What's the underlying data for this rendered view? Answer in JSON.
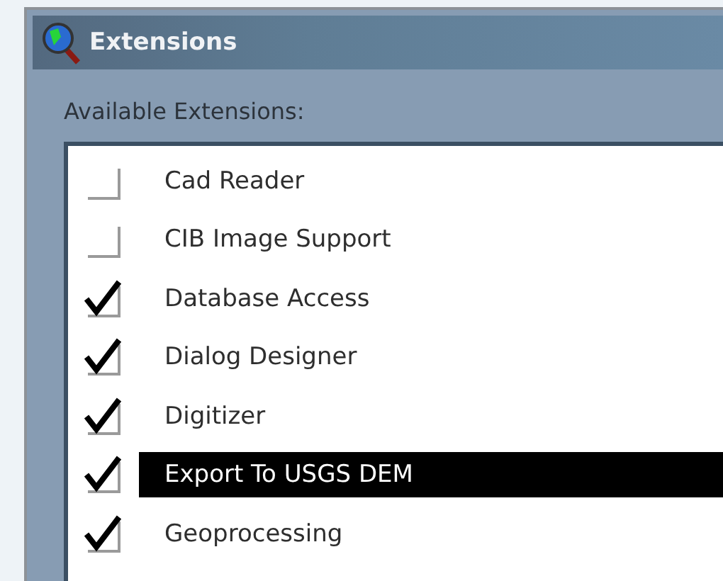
{
  "window": {
    "title": "Extensions"
  },
  "list_label": "Available Extensions:",
  "extensions": [
    {
      "name": "Cad Reader",
      "checked": false,
      "selected": false
    },
    {
      "name": "CIB Image Support",
      "checked": false,
      "selected": false
    },
    {
      "name": "Database Access",
      "checked": true,
      "selected": false
    },
    {
      "name": "Dialog Designer",
      "checked": true,
      "selected": false
    },
    {
      "name": "Digitizer",
      "checked": true,
      "selected": false
    },
    {
      "name": "Export To USGS DEM",
      "checked": true,
      "selected": true
    },
    {
      "name": "Geoprocessing",
      "checked": true,
      "selected": false
    }
  ]
}
